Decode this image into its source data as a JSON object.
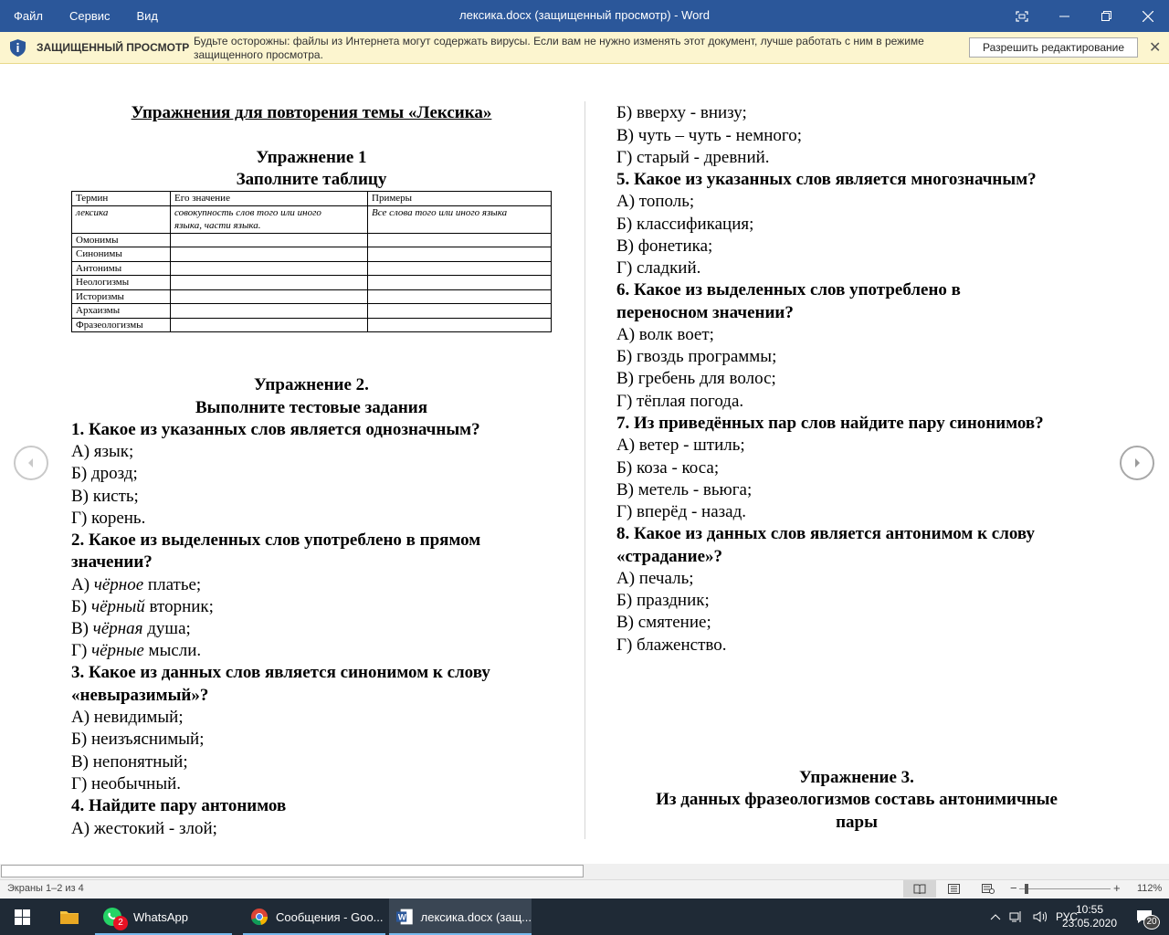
{
  "window": {
    "title": "лексика.docx (защищенный просмотр) - Word",
    "menu": [
      "Файл",
      "Сервис",
      "Вид"
    ]
  },
  "protected_view": {
    "label": "ЗАЩИЩЕННЫЙ ПРОСМОТР",
    "message": "Будьте осторожны: файлы из Интернета могут содержать вирусы. Если вам не нужно изменять этот документ, лучше работать с ним в режиме защищенного просмотра.",
    "enable_button": "Разрешить редактирование"
  },
  "document": {
    "left": {
      "heading": "Упражнения для повторения темы «Лексика»",
      "ex1_title": "Упражнение 1",
      "ex1_task": "Заполните таблицу",
      "table": {
        "headers": [
          "Термин",
          "Его значение",
          "Примеры"
        ],
        "row1": [
          "лексика",
          "совокупность слов того или иного",
          "языка, части языка.",
          "Все слова того или иного языка"
        ],
        "terms": [
          "Омонимы",
          "Синонимы",
          "Антонимы",
          "Неологизмы",
          "Историзмы",
          "Архаизмы",
          "Фразеологизмы"
        ]
      },
      "ex2_title": "Упражнение 2.",
      "ex2_task": "Выполните тестовые задания",
      "q1": "1. Какое из указанных слов является однозначным?",
      "q1_a": "А) язык;",
      "q1_b": "Б) дрозд;",
      "q1_c": "В) кисть;",
      "q1_d": "Г) корень.",
      "q2_1": "2. Какое из выделенных слов употреблено в прямом",
      "q2_2": "значении?",
      "q2_a": [
        "А) ",
        "чёрное",
        " платье;"
      ],
      "q2_b": [
        "Б) ",
        "чёрный",
        " вторник;"
      ],
      "q2_c": [
        "В) ",
        "чёрная",
        " душа;"
      ],
      "q2_d": [
        "Г) ",
        "чёрные",
        " мысли."
      ],
      "q3_1": "3. Какое из данных слов является синонимом к слову",
      "q3_2": "«невыразимый»?",
      "q3_a": "А) невидимый;",
      "q3_b": "Б) неизъяснимый;",
      "q3_c": "В) непонятный;",
      "q3_d": "Г) необычный.",
      "q4": "4. Найдите пару антонимов",
      "q4_a": "А) жестокий - злой;"
    },
    "right": {
      "q4_b": "Б) вверху - внизу;",
      "q4_c": "В) чуть – чуть - немного;",
      "q4_d": "Г) старый - древний.",
      "q5": "5. Какое из указанных слов является многозначным?",
      "q5_a": "А) тополь;",
      "q5_b": "Б) классификация;",
      "q5_c": "В) фонетика;",
      "q5_d": "Г) сладкий.",
      "q6_1": "6. Какое из выделенных слов употреблено в",
      "q6_2": "переносном  значении?",
      "q6_a": "А) волк воет;",
      "q6_b": "Б) гвоздь программы;",
      "q6_c": "В) гребень для волос;",
      "q6_d": "Г) тёплая погода.",
      "q7": "7. Из приведённых пар слов найдите  пару синонимов?",
      "q7_a": "А) ветер - штиль;",
      "q7_b": "Б) коза - коса;",
      "q7_c": "В) метель - вьюга;",
      "q7_d": "Г) вперёд - назад.",
      "q8_1": "8. Какое из данных слов является антонимом к слову",
      "q8_2": "«страдание»?",
      "q8_a": "А) печаль;",
      "q8_b": "Б) праздник;",
      "q8_c": "В) смятение;",
      "q8_d": "Г) блаженство.",
      "ex3_title": "Упражнение 3.",
      "ex3_task_1": "Из данных фразеологизмов составь антонимичные",
      "ex3_task_2": "пары"
    }
  },
  "status": {
    "pages": "Экраны 1–2 из 4",
    "zoom": "112%"
  },
  "taskbar": {
    "apps": [
      {
        "label": "WhatsApp",
        "badge": "2"
      },
      {
        "label": "Сообщения - Goo..."
      },
      {
        "label": "лексика.docx (защ..."
      }
    ],
    "lang": "РУС",
    "time": "10:55",
    "date": "23.05.2020",
    "notifications": "20"
  },
  "colors": {
    "titlebar": "#2b579a",
    "protected_bar": "#fcf5cf",
    "taskbar": "#1f2a36"
  }
}
